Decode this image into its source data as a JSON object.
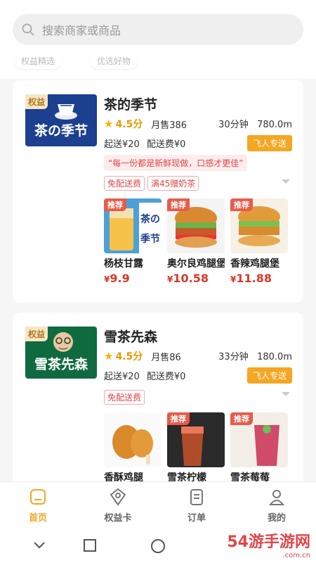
{
  "search": {
    "placeholder": "搜索商家或商品"
  },
  "chips": [
    "权益精选",
    "优选好物"
  ],
  "stores": [
    {
      "badge": "权益",
      "logo_text": "茶の季节",
      "name": "茶的季节",
      "rating": "4.5分",
      "sales": "月售386",
      "time": "30分钟",
      "distance": "780.0m",
      "min_order": "起送¥20",
      "delivery_fee": "配送费¥0",
      "delivery_tag": "飞人专送",
      "quote": "“每一份都是新鲜现做，口感才更佳”",
      "tags": [
        "免配送费",
        "满45赠奶茶"
      ],
      "products": [
        {
          "rec": "推荐",
          "name": "杨枝甘露",
          "price": "9.9",
          "img": "drink-cup"
        },
        {
          "rec": "推荐",
          "name": "奥尔良鸡腿堡",
          "price": "10.58",
          "img": "burger"
        },
        {
          "rec": "推荐",
          "name": "香辣鸡腿堡",
          "price": "11.88",
          "img": "burger"
        }
      ]
    },
    {
      "badge": "权益",
      "logo_text": "雪茶先森",
      "name": "雪茶先森",
      "rating": "4.5分",
      "sales": "月售86",
      "time": "33分钟",
      "distance": "180.0m",
      "min_order": "起送¥20",
      "delivery_fee": "配送费¥0",
      "delivery_tag": "飞人专送",
      "tags": [
        "免配送费"
      ],
      "products": [
        {
          "rec": "",
          "name": "香酥鸡腿",
          "price": "",
          "img": "chicken"
        },
        {
          "rec": "推荐",
          "name": "雪茶柠檬",
          "price": "",
          "img": "drink-cup"
        },
        {
          "rec": "推荐",
          "name": "雪茶莓莓",
          "price": "",
          "img": "drink-cup"
        }
      ]
    }
  ],
  "nav": [
    {
      "label": "首页",
      "icon": "home-icon",
      "active": true
    },
    {
      "label": "权益卡",
      "icon": "diamond-icon",
      "active": false
    },
    {
      "label": "订单",
      "icon": "order-icon",
      "active": false
    },
    {
      "label": "我的",
      "icon": "user-icon",
      "active": false
    }
  ],
  "watermark": {
    "main": "54游手游网",
    "sub": ".com.cn"
  },
  "colors": {
    "accent": "#f5a623",
    "price": "#d63a2a",
    "logo1": "#1c3f8f",
    "logo2": "#0f6a3f"
  }
}
